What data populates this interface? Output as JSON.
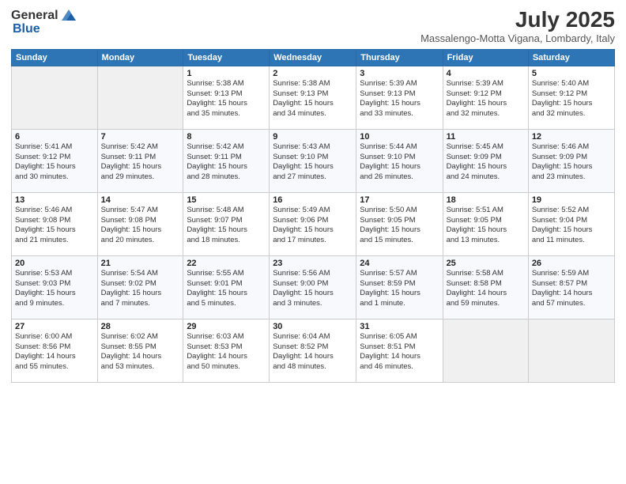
{
  "logo": {
    "general": "General",
    "blue": "Blue"
  },
  "title": {
    "month_year": "July 2025",
    "location": "Massalengo-Motta Vigana, Lombardy, Italy"
  },
  "headers": [
    "Sunday",
    "Monday",
    "Tuesday",
    "Wednesday",
    "Thursday",
    "Friday",
    "Saturday"
  ],
  "weeks": [
    [
      {
        "day": "",
        "info": ""
      },
      {
        "day": "",
        "info": ""
      },
      {
        "day": "1",
        "info": "Sunrise: 5:38 AM\nSunset: 9:13 PM\nDaylight: 15 hours\nand 35 minutes."
      },
      {
        "day": "2",
        "info": "Sunrise: 5:38 AM\nSunset: 9:13 PM\nDaylight: 15 hours\nand 34 minutes."
      },
      {
        "day": "3",
        "info": "Sunrise: 5:39 AM\nSunset: 9:13 PM\nDaylight: 15 hours\nand 33 minutes."
      },
      {
        "day": "4",
        "info": "Sunrise: 5:39 AM\nSunset: 9:12 PM\nDaylight: 15 hours\nand 32 minutes."
      },
      {
        "day": "5",
        "info": "Sunrise: 5:40 AM\nSunset: 9:12 PM\nDaylight: 15 hours\nand 32 minutes."
      }
    ],
    [
      {
        "day": "6",
        "info": "Sunrise: 5:41 AM\nSunset: 9:12 PM\nDaylight: 15 hours\nand 30 minutes."
      },
      {
        "day": "7",
        "info": "Sunrise: 5:42 AM\nSunset: 9:11 PM\nDaylight: 15 hours\nand 29 minutes."
      },
      {
        "day": "8",
        "info": "Sunrise: 5:42 AM\nSunset: 9:11 PM\nDaylight: 15 hours\nand 28 minutes."
      },
      {
        "day": "9",
        "info": "Sunrise: 5:43 AM\nSunset: 9:10 PM\nDaylight: 15 hours\nand 27 minutes."
      },
      {
        "day": "10",
        "info": "Sunrise: 5:44 AM\nSunset: 9:10 PM\nDaylight: 15 hours\nand 26 minutes."
      },
      {
        "day": "11",
        "info": "Sunrise: 5:45 AM\nSunset: 9:09 PM\nDaylight: 15 hours\nand 24 minutes."
      },
      {
        "day": "12",
        "info": "Sunrise: 5:46 AM\nSunset: 9:09 PM\nDaylight: 15 hours\nand 23 minutes."
      }
    ],
    [
      {
        "day": "13",
        "info": "Sunrise: 5:46 AM\nSunset: 9:08 PM\nDaylight: 15 hours\nand 21 minutes."
      },
      {
        "day": "14",
        "info": "Sunrise: 5:47 AM\nSunset: 9:08 PM\nDaylight: 15 hours\nand 20 minutes."
      },
      {
        "day": "15",
        "info": "Sunrise: 5:48 AM\nSunset: 9:07 PM\nDaylight: 15 hours\nand 18 minutes."
      },
      {
        "day": "16",
        "info": "Sunrise: 5:49 AM\nSunset: 9:06 PM\nDaylight: 15 hours\nand 17 minutes."
      },
      {
        "day": "17",
        "info": "Sunrise: 5:50 AM\nSunset: 9:05 PM\nDaylight: 15 hours\nand 15 minutes."
      },
      {
        "day": "18",
        "info": "Sunrise: 5:51 AM\nSunset: 9:05 PM\nDaylight: 15 hours\nand 13 minutes."
      },
      {
        "day": "19",
        "info": "Sunrise: 5:52 AM\nSunset: 9:04 PM\nDaylight: 15 hours\nand 11 minutes."
      }
    ],
    [
      {
        "day": "20",
        "info": "Sunrise: 5:53 AM\nSunset: 9:03 PM\nDaylight: 15 hours\nand 9 minutes."
      },
      {
        "day": "21",
        "info": "Sunrise: 5:54 AM\nSunset: 9:02 PM\nDaylight: 15 hours\nand 7 minutes."
      },
      {
        "day": "22",
        "info": "Sunrise: 5:55 AM\nSunset: 9:01 PM\nDaylight: 15 hours\nand 5 minutes."
      },
      {
        "day": "23",
        "info": "Sunrise: 5:56 AM\nSunset: 9:00 PM\nDaylight: 15 hours\nand 3 minutes."
      },
      {
        "day": "24",
        "info": "Sunrise: 5:57 AM\nSunset: 8:59 PM\nDaylight: 15 hours\nand 1 minute."
      },
      {
        "day": "25",
        "info": "Sunrise: 5:58 AM\nSunset: 8:58 PM\nDaylight: 14 hours\nand 59 minutes."
      },
      {
        "day": "26",
        "info": "Sunrise: 5:59 AM\nSunset: 8:57 PM\nDaylight: 14 hours\nand 57 minutes."
      }
    ],
    [
      {
        "day": "27",
        "info": "Sunrise: 6:00 AM\nSunset: 8:56 PM\nDaylight: 14 hours\nand 55 minutes."
      },
      {
        "day": "28",
        "info": "Sunrise: 6:02 AM\nSunset: 8:55 PM\nDaylight: 14 hours\nand 53 minutes."
      },
      {
        "day": "29",
        "info": "Sunrise: 6:03 AM\nSunset: 8:53 PM\nDaylight: 14 hours\nand 50 minutes."
      },
      {
        "day": "30",
        "info": "Sunrise: 6:04 AM\nSunset: 8:52 PM\nDaylight: 14 hours\nand 48 minutes."
      },
      {
        "day": "31",
        "info": "Sunrise: 6:05 AM\nSunset: 8:51 PM\nDaylight: 14 hours\nand 46 minutes."
      },
      {
        "day": "",
        "info": ""
      },
      {
        "day": "",
        "info": ""
      }
    ]
  ]
}
